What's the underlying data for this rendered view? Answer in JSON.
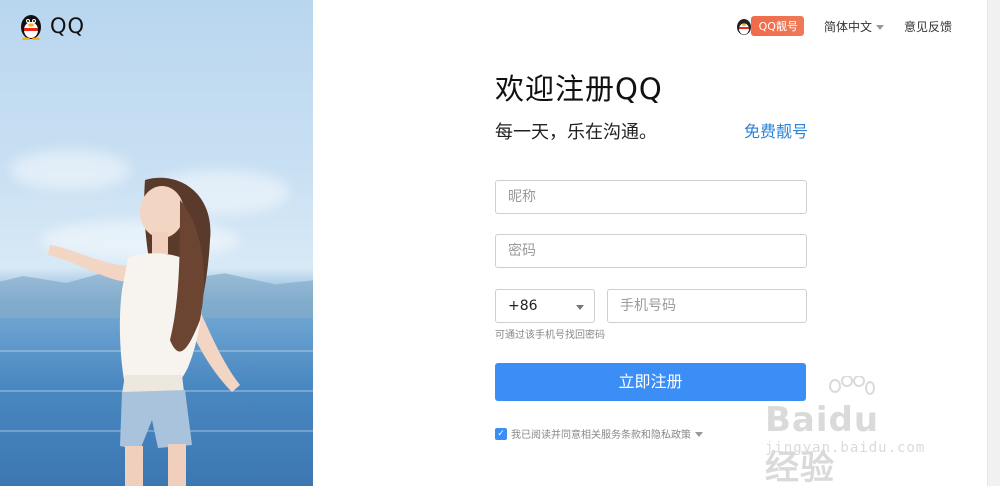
{
  "brand": {
    "name": "QQ"
  },
  "topnav": {
    "badge": "QQ靓号",
    "language": "简体中文",
    "feedback": "意见反馈"
  },
  "form": {
    "title": "欢迎注册QQ",
    "subtitle": "每一天，乐在沟通。",
    "free_number": "免费靓号",
    "nickname_placeholder": "昵称",
    "password_placeholder": "密码",
    "country_code": "+86",
    "phone_placeholder": "手机号码",
    "phone_hint": "可通过该手机号找回密码",
    "submit": "立即注册",
    "agreement": "我已阅读并同意相关服务条款和隐私政策",
    "agreement_checked": true
  },
  "watermark": {
    "text": "Baidu经验",
    "url": "jingyan.baidu.com"
  },
  "colors": {
    "accent": "#3a8ef5",
    "link": "#2b83d8",
    "badge": "#f06a4a"
  },
  "icons": [
    "qq-penguin-icon",
    "chevron-down-icon",
    "checkbox-checked-icon",
    "baidu-paw-icon"
  ]
}
